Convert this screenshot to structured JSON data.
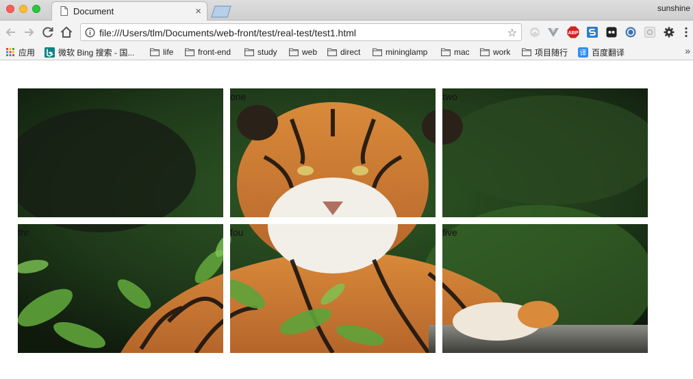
{
  "browser": {
    "tab_title": "Document",
    "profile_name": "sunshine",
    "url": "file:///Users/tlm/Documents/web-front/test/real-test/test1.html"
  },
  "bookmarks": [
    {
      "label": "应用",
      "icon": "apps-grid-icon"
    },
    {
      "label": "微软 Bing 搜索 - 国...",
      "icon": "bing-icon"
    },
    {
      "label": "life",
      "icon": "folder-icon"
    },
    {
      "label": "front-end",
      "icon": "folder-icon"
    },
    {
      "label": "study",
      "icon": "folder-icon"
    },
    {
      "label": "web",
      "icon": "folder-icon"
    },
    {
      "label": "direct",
      "icon": "folder-icon"
    },
    {
      "label": "mininglamp",
      "icon": "folder-icon"
    },
    {
      "label": "mac",
      "icon": "folder-icon"
    },
    {
      "label": "work",
      "icon": "folder-icon"
    },
    {
      "label": "项目随行",
      "icon": "folder-icon"
    },
    {
      "label": "百度翻译",
      "icon": "baidu-translate-icon"
    }
  ],
  "extensions": [
    "vpn-icon",
    "vue-devtools-icon",
    "adblock-plus-icon",
    "s-extension-icon",
    "ghostery-icon",
    "sync-icon",
    "screenshot-icon",
    "settings-gear-icon",
    "menu-dots-icon"
  ],
  "extension_labels": {
    "adblock": "ABP"
  },
  "cells": [
    {
      "label": "",
      "name": "zero"
    },
    {
      "label": "one",
      "name": "one"
    },
    {
      "label": "two",
      "name": "two"
    },
    {
      "label": "thr",
      "name": "three"
    },
    {
      "label": "fou",
      "name": "four"
    },
    {
      "label": "five",
      "name": "five"
    }
  ],
  "colors": {
    "foliage_dark": "#1e2a1a",
    "foliage_green": "#3f7a2a",
    "tiger_orange": "#c7762c",
    "tiger_stripe": "#1a1410"
  }
}
